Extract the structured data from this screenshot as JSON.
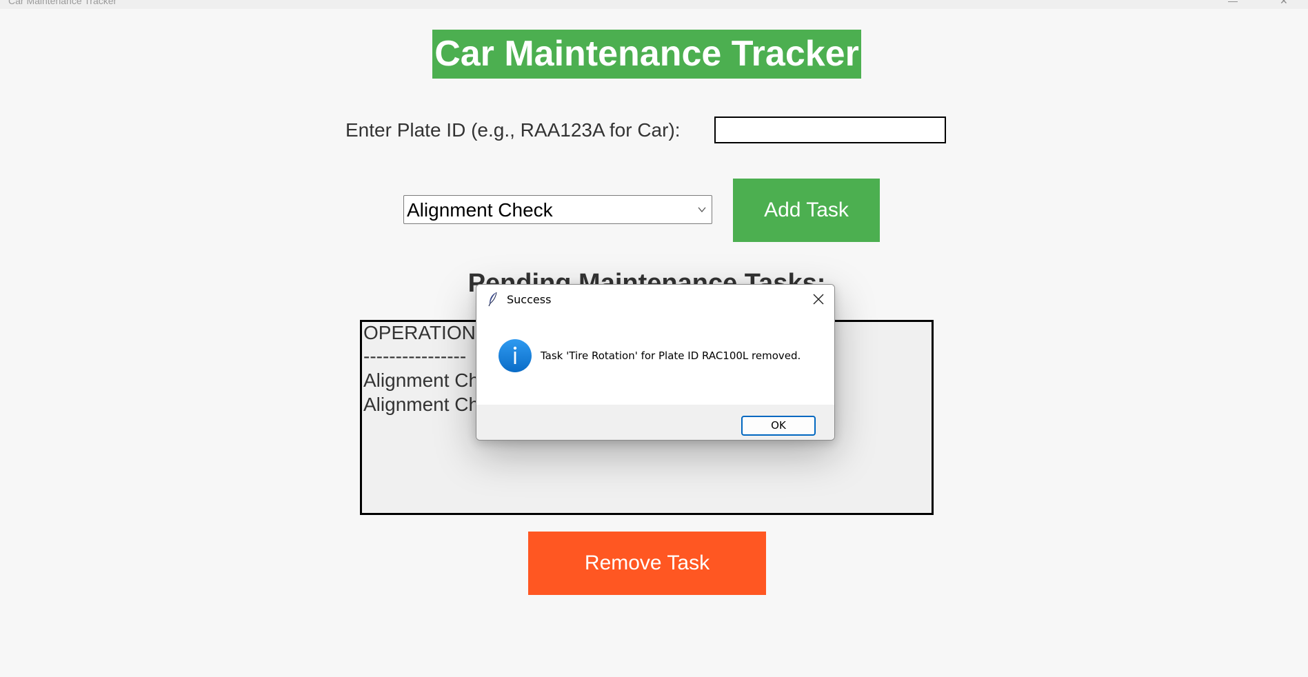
{
  "window": {
    "title": "Car Maintenance Tracker",
    "controls": {
      "minimize": "—",
      "close": "✕"
    }
  },
  "app": {
    "title": "Car Maintenance Tracker",
    "plate_label": "Enter Plate ID (e.g., RAA123A for Car):",
    "plate_value": "",
    "selected_task": "Alignment Check",
    "add_button": "Add Task",
    "pending_heading": "Pending Maintenance Tasks:",
    "list_lines": [
      "OPERATION",
      "----------------",
      "Alignment Ch",
      "Alignment Ch"
    ],
    "remove_button": "Remove Task"
  },
  "dialog": {
    "title": "Success",
    "icon": "info-icon",
    "message": "Task 'Tire Rotation' for Plate ID RAC100L removed.",
    "ok_button": "OK"
  },
  "colors": {
    "green": "#4caf50",
    "orange": "#ff5722",
    "info_blue": "#1a7fd6",
    "focus_blue": "#0067c0"
  }
}
